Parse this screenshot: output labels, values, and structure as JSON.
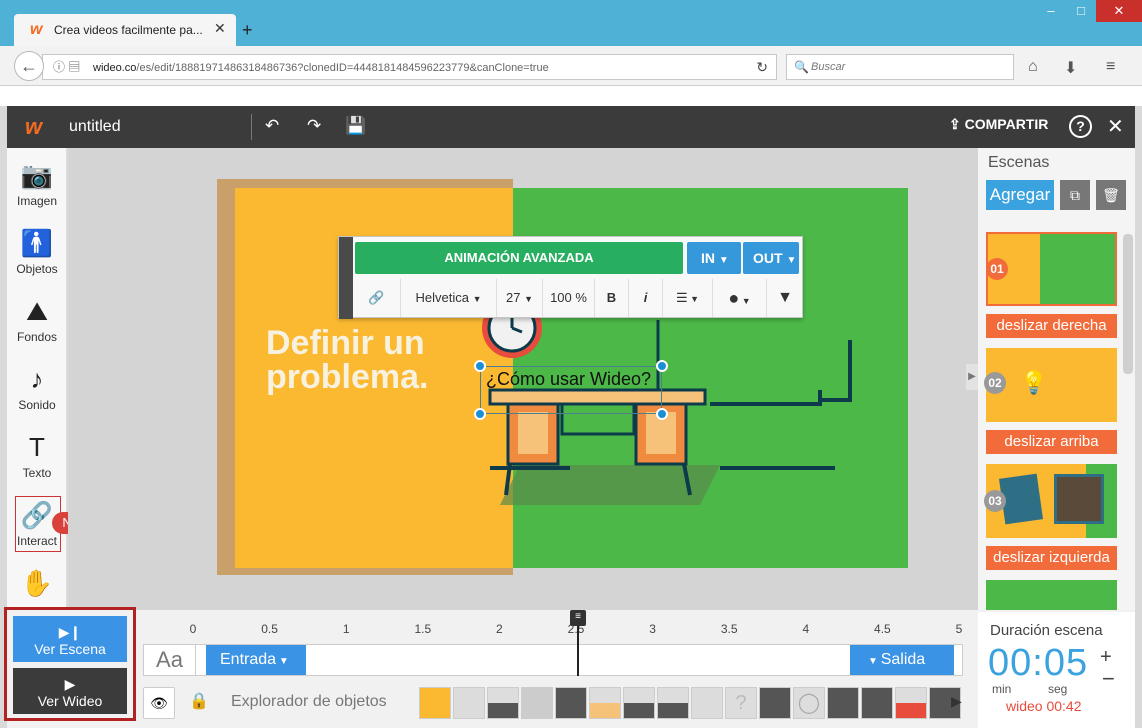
{
  "browser": {
    "tab_title": "Crea videos facilmente pa...",
    "url_domain": "wideo.co",
    "url_path": "/es/edit/18881971486318486736?clonedID=4448181484596223779&canClone=true",
    "search_placeholder": "Buscar"
  },
  "app": {
    "doc_name": "untitled",
    "share_label": "COMPARTIR",
    "help_label": "?"
  },
  "tools": [
    {
      "label": "Imagen",
      "icon": "camera-icon",
      "glyph": "📷"
    },
    {
      "label": "Objetos",
      "icon": "person-icon",
      "glyph": "🚹"
    },
    {
      "label": "Fondos",
      "icon": "landscape-icon",
      "glyph": "⛰"
    },
    {
      "label": "Sonido",
      "icon": "music-note-icon",
      "glyph": "♪"
    },
    {
      "label": "Texto",
      "icon": "text-icon",
      "glyph": "T"
    },
    {
      "label": "Interact",
      "icon": "link-icon",
      "glyph": "🔗"
    }
  ],
  "new_badge": "Nuevo!",
  "canvas": {
    "headline": "Definir un problema.",
    "selected_text": "¿Cómo usar Wideo?"
  },
  "text_toolbar": {
    "advanced_anim": "ANIMACIÓN AVANZADA",
    "in_label": "IN",
    "out_label": "OUT",
    "font": "Helvetica",
    "size": "27",
    "opacity": "100 %",
    "bold": "B",
    "italic": "i"
  },
  "scenes": {
    "header": "Escenas",
    "add_label": "Agregar",
    "items": [
      {
        "num": "01",
        "transition": "deslizar derecha"
      },
      {
        "num": "02",
        "transition": "deslizar arriba"
      },
      {
        "num": "03",
        "transition": "deslizar izquierda"
      }
    ]
  },
  "playback": {
    "scene_label": "Ver Escena",
    "video_label": "Ver Wideo"
  },
  "timeline": {
    "ticks": [
      "0",
      "0.5",
      "1",
      "1.5",
      "2",
      "2.5",
      "3",
      "3.5",
      "4",
      "4.5",
      "5"
    ],
    "aa_label": "Aa",
    "entrada": "Entrada",
    "salida": "Salida",
    "explorer": "Explorador de objetos"
  },
  "duration": {
    "label": "Duración escena",
    "time": "00:05",
    "min": "min",
    "seg": "seg",
    "total": "wideo 00:42"
  },
  "colors": {
    "accent_blue": "#3b93e6",
    "scene_yellow": "#fbb932",
    "scene_green": "#4cb848",
    "transition_orange": "#f26b3a"
  }
}
